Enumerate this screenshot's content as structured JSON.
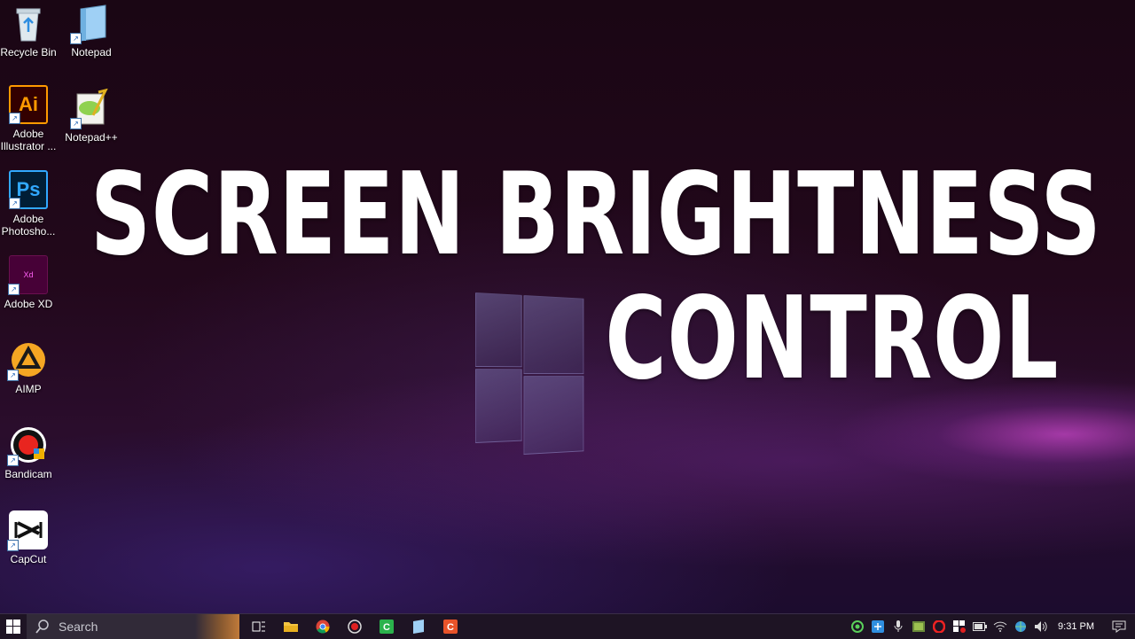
{
  "desktop": {
    "icons": [
      {
        "name": "recycle-bin-icon",
        "label": "Recycle Bin"
      },
      {
        "name": "notepad-icon",
        "label": "Notepad"
      },
      {
        "name": "adobe-illustrator-icon",
        "label": "Adobe Illustrator ...",
        "glyph": "Ai"
      },
      {
        "name": "notepad-plus-plus-icon",
        "label": "Notepad++"
      },
      {
        "name": "adobe-photoshop-icon",
        "label": "Adobe Photosho...",
        "glyph": "Ps"
      },
      {
        "name": "adobe-xd-icon",
        "label": "Adobe XD",
        "glyph": "Xd"
      },
      {
        "name": "aimp-icon",
        "label": "AIMP"
      },
      {
        "name": "bandicam-icon",
        "label": "Bandicam"
      },
      {
        "name": "capcut-icon",
        "label": "CapCut"
      }
    ]
  },
  "overlay": {
    "line1": "SCREEN BRIGHTNESS",
    "line2": "CONTROL"
  },
  "taskbar": {
    "search_placeholder": "Search",
    "pinned": [
      "task-view-icon",
      "file-explorer-icon",
      "chrome-icon",
      "record-icon",
      "camtasia-icon",
      "notepad-taskbar-icon",
      "capcut-taskbar-icon"
    ],
    "tray": [
      "green-circle-icon",
      "shield-blue-icon",
      "microphone-icon",
      "gpu-icon",
      "opera-icon",
      "windows-security-icon",
      "battery-icon",
      "wifi-icon",
      "network-icon",
      "volume-icon"
    ],
    "clock": "9:31 PM"
  },
  "colors": {
    "illustrator": "#ff9a00",
    "photoshop": "#31a8ff",
    "xd": "#ff61f6",
    "aimp": "#f5a623"
  }
}
